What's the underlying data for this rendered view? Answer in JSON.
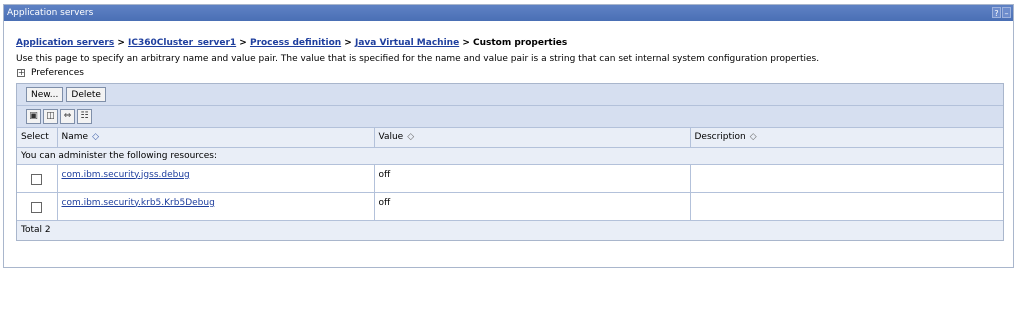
{
  "window": {
    "title": "Application servers",
    "help_icon": "?",
    "minimize_icon": "–"
  },
  "breadcrumb": {
    "items": [
      "Application servers",
      "IC360Cluster_server1",
      "Process definition",
      "Java Virtual Machine"
    ],
    "separator": " > ",
    "current": "Custom properties"
  },
  "description": "Use this page to specify an arbitrary name and value pair. The value that is specified for the name and value pair is a string that can set internal system configuration properties.",
  "preferences": {
    "label": "Preferences",
    "toggle": "+"
  },
  "toolbar": {
    "new_label": "New...",
    "delete_label": "Delete"
  },
  "tool_icons": [
    "select-all-icon",
    "deselect-all-icon",
    "expand-filter-icon",
    "clear-filter-icon"
  ],
  "table": {
    "headers": {
      "select": "Select",
      "name": "Name",
      "value": "Value",
      "description": "Description"
    },
    "admin_message": "You can administer the following resources:",
    "rows": [
      {
        "name": "com.ibm.security.jgss.debug",
        "value": "off",
        "description": ""
      },
      {
        "name": "com.ibm.security.krb5.Krb5Debug",
        "value": "off",
        "description": ""
      }
    ],
    "total": "Total 2"
  }
}
